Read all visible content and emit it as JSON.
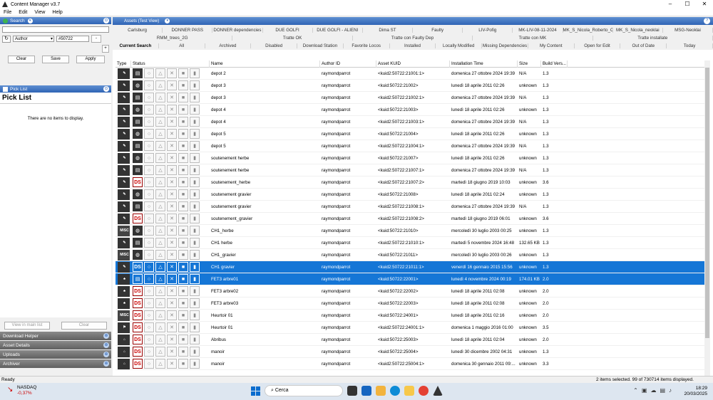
{
  "window": {
    "title": "Content Manager v3.7"
  },
  "menu": [
    "File",
    "Edit",
    "View",
    "Help"
  ],
  "search": {
    "header": "Search",
    "field": "Author",
    "value": "#50722",
    "remove": "-",
    "add": "+",
    "clear": "Clear",
    "save": "Save",
    "apply": "Apply"
  },
  "picklist": {
    "header": "Pick List",
    "title": "Pick List",
    "empty": "There are no items to display.",
    "view_main": "View in main list",
    "clear": "Clear"
  },
  "collapsed_panels": [
    "Download Helper",
    "Asset Details",
    "Uploads",
    "Archiver"
  ],
  "assets_tab": "Assets (Test View)",
  "tab_rows": [
    [
      "Carlsburg",
      "DONNER PASS",
      "DONNER dependencies",
      "DUE GOLFI",
      "DUE GOLFI - ALIENI",
      "Dima ST",
      "Faulty",
      "LIV-Pofig",
      "MK-LIV-08-11-2024",
      "MK_S_Nicola_Roberto_Conti",
      "MK_S_Nicola_neoklai",
      "MSG-Neoklai"
    ],
    [
      "RMM_trees_2G",
      "Tratte OK",
      "Tratte con Faulty Dep",
      "Tratte con MK",
      "Tratte installate"
    ],
    [
      "Current Search",
      "All",
      "Archived",
      "Disabled",
      "Download Station",
      "Favorite Locos",
      "Installed",
      "Locally Modified",
      "Missing Dependencies",
      "My Content",
      "Open for Edit",
      "Out of Date",
      "Today"
    ]
  ],
  "columns": [
    "Type",
    "Status",
    "Name",
    "Author ID",
    "Asset KUID",
    "Installation Time",
    "Size",
    "Build Vers..."
  ],
  "rows": [
    {
      "type": "loco",
      "ph": "book",
      "name": "depot 2",
      "author": "raymondparrot",
      "kuid": "<kuid2:50722:21001:1>",
      "time": "domenica 27 ottobre 2024 19:39",
      "size": "N/A",
      "build": "1.3",
      "sel": false
    },
    {
      "type": "loco",
      "ph": "db",
      "name": "depot 3",
      "author": "raymondparrot",
      "kuid": "<kuid:50722:21002>",
      "time": "lunedì 18 aprile 2011 02:26",
      "size": "unknown",
      "build": "1.3",
      "sel": false
    },
    {
      "type": "loco",
      "ph": "book",
      "name": "depot 3",
      "author": "raymondparrot",
      "kuid": "<kuid2:50722:21002:1>",
      "time": "domenica 27 ottobre 2024 19:39",
      "size": "N/A",
      "build": "1.3",
      "sel": false
    },
    {
      "type": "loco",
      "ph": "db",
      "name": "depot 4",
      "author": "raymondparrot",
      "kuid": "<kuid:50722:21003>",
      "time": "lunedì 18 aprile 2011 02:26",
      "size": "unknown",
      "build": "1.3",
      "sel": false
    },
    {
      "type": "loco",
      "ph": "book",
      "name": "depot 4",
      "author": "raymondparrot",
      "kuid": "<kuid2:50722:21003:1>",
      "time": "domenica 27 ottobre 2024 19:39",
      "size": "N/A",
      "build": "1.3",
      "sel": false
    },
    {
      "type": "loco",
      "ph": "db",
      "name": "depot 5",
      "author": "raymondparrot",
      "kuid": "<kuid:50722:21004>",
      "time": "lunedì 18 aprile 2011 02:26",
      "size": "unknown",
      "build": "1.3",
      "sel": false
    },
    {
      "type": "loco",
      "ph": "book",
      "name": "depot 5",
      "author": "raymondparrot",
      "kuid": "<kuid2:50722:21004:1>",
      "time": "domenica 27 ottobre 2024 19:39",
      "size": "N/A",
      "build": "1.3",
      "sel": false
    },
    {
      "type": "loco",
      "ph": "db",
      "name": "soutenement herbe",
      "author": "raymondparrot",
      "kuid": "<kuid:50722:21007>",
      "time": "lunedì 18 aprile 2011 02:26",
      "size": "unknown",
      "build": "1.3",
      "sel": false
    },
    {
      "type": "loco",
      "ph": "book",
      "name": "soutenement herbe",
      "author": "raymondparrot",
      "kuid": "<kuid2:50722:21007:1>",
      "time": "domenica 27 ottobre 2024 19:39",
      "size": "N/A",
      "build": "1.3",
      "sel": false
    },
    {
      "type": "loco",
      "ph": "ds",
      "name": "soutenement_herbe",
      "author": "raymondparrot",
      "kuid": "<kuid2:50722:21007:2>",
      "time": "martedì 18 giugno 2019 10:03",
      "size": "unknown",
      "build": "3.6",
      "sel": false
    },
    {
      "type": "loco",
      "ph": "db",
      "name": "soutenement gravier",
      "author": "raymondparrot",
      "kuid": "<kuid:50722:21008>",
      "time": "lunedì 18 aprile 2011 02:24",
      "size": "unknown",
      "build": "1.3",
      "sel": false
    },
    {
      "type": "loco",
      "ph": "book",
      "name": "soutenement gravier",
      "author": "raymondparrot",
      "kuid": "<kuid2:50722:21008:1>",
      "time": "domenica 27 ottobre 2024 19:39",
      "size": "N/A",
      "build": "1.3",
      "sel": false
    },
    {
      "type": "loco",
      "ph": "ds",
      "name": "soutenement_gravier",
      "author": "raymondparrot",
      "kuid": "<kuid2:50722:21008:2>",
      "time": "martedì 18 giugno 2019 06:01",
      "size": "unknown",
      "build": "3.6",
      "sel": false
    },
    {
      "type": "misc",
      "ph": "db",
      "name": "CH1_herbe",
      "author": "raymondparrot",
      "kuid": "<kuid:50722:21010>",
      "time": "mercoledì 30 luglio 2003 00:25",
      "size": "unknown",
      "build": "1.3",
      "sel": false
    },
    {
      "type": "loco",
      "ph": "book",
      "name": "CH1 herbe",
      "author": "raymondparrot",
      "kuid": "<kuid2:50722:21010:1>",
      "time": "martedì 5 novembre 2024 16:48",
      "size": "132.65 KB",
      "build": "1.3",
      "sel": false
    },
    {
      "type": "misc",
      "ph": "db",
      "name": "CH1_gravier",
      "author": "raymondparrot",
      "kuid": "<kuid:50722:21011>",
      "time": "mercoledì 30 luglio 2003 00:26",
      "size": "unknown",
      "build": "1.3",
      "sel": false
    },
    {
      "type": "loco",
      "ph": "ds",
      "name": "CH1 gravier",
      "author": "raymondparrot",
      "kuid": "<kuid2:50722:21011:1>",
      "time": "venerdì 16 gennaio 2015 15:56",
      "size": "unknown",
      "build": "1.3",
      "sel": true
    },
    {
      "type": "tree",
      "ph": "book",
      "name": "FET3 arbre01",
      "author": "raymondparrot",
      "kuid": "<kuid:50722:22001>",
      "time": "lunedì 4 novembre 2024 00:19",
      "size": "174.01 KB",
      "build": "2.0",
      "sel": true
    },
    {
      "type": "tree",
      "ph": "ds",
      "name": "FET3 arbre02",
      "author": "raymondparrot",
      "kuid": "<kuid:50722:22002>",
      "time": "lunedì 18 aprile 2011 02:08",
      "size": "unknown",
      "build": "2.0",
      "sel": false
    },
    {
      "type": "tree",
      "ph": "ds",
      "name": "FET3 arbre03",
      "author": "raymondparrot",
      "kuid": "<kuid:50722:22003>",
      "time": "lunedì 18 aprile 2011 02:08",
      "size": "unknown",
      "build": "2.0",
      "sel": false
    },
    {
      "type": "misc",
      "ph": "ds",
      "name": "Heurtoir 01",
      "author": "raymondparrot",
      "kuid": "<kuid:50722:24001>",
      "time": "lunedì 18 aprile 2011 02:16",
      "size": "unknown",
      "build": "2.0",
      "sel": false
    },
    {
      "type": "misc2",
      "ph": "ds",
      "name": "Heurtoir 01",
      "author": "raymondparrot",
      "kuid": "<kuid2:50722:24001:1>",
      "time": "domenica 1 maggio 2016 01:00",
      "size": "unknown",
      "build": "3.5",
      "sel": false
    },
    {
      "type": "shelter",
      "ph": "ds",
      "name": "Abribus",
      "author": "raymondparrot",
      "kuid": "<kuid:50722:25003>",
      "time": "lunedì 18 aprile 2011 02:04",
      "size": "unknown",
      "build": "2.0",
      "sel": false
    },
    {
      "type": "shelter",
      "ph": "ds",
      "name": "manoir",
      "author": "raymondparrot",
      "kuid": "<kuid:50722:25004>",
      "time": "lunedì 30 dicembre 2002 04:31",
      "size": "unknown",
      "build": "1.3",
      "sel": false
    },
    {
      "type": "shelter",
      "ph": "ds",
      "name": "manoir",
      "author": "raymondparrot",
      "kuid": "<kuid2:50722:25004:1>",
      "time": "domenica 30 gennaio 2011 09:...",
      "size": "unknown",
      "build": "3.3",
      "sel": false
    }
  ],
  "status": {
    "left": "Ready",
    "right": "2 items selected. 99 of 730714 items displayed."
  },
  "taskbar": {
    "stock_name": "NASDAQ",
    "stock_change": "-0,37%",
    "search": "Cerca",
    "time": "18:29",
    "date": "20/03/2025"
  }
}
